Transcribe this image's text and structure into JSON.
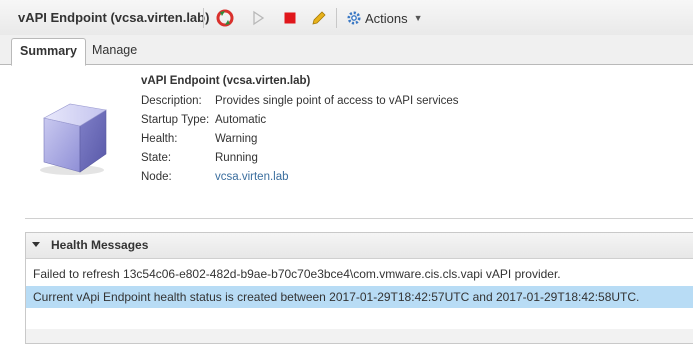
{
  "header": {
    "title": "vAPI Endpoint (vcsa.virten.lab)",
    "actions_label": "Actions",
    "toolbar_icons": [
      "refresh-icon",
      "play-icon",
      "stop-icon",
      "edit-icon",
      "gear-icon"
    ],
    "colors": {
      "refresh": "#d9302c",
      "stop": "#e0161b",
      "edit": "#e8b21a",
      "gear": "#3a78c4"
    }
  },
  "tabs": [
    {
      "label": "Summary",
      "active": true
    },
    {
      "label": "Manage",
      "active": false
    }
  ],
  "summary": {
    "name": "vAPI Endpoint (vcsa.virten.lab)",
    "fields": [
      {
        "key": "Description:",
        "value": "Provides single point of access to vAPI services"
      },
      {
        "key": "Startup Type:",
        "value": "Automatic"
      },
      {
        "key": "Health:",
        "value": "Warning"
      },
      {
        "key": "State:",
        "value": "Running"
      },
      {
        "key": "Node:",
        "value": "vcsa.virten.lab"
      }
    ]
  },
  "health": {
    "title": "Health Messages",
    "messages": [
      "Failed to refresh 13c54c06-e802-482d-b9ae-b70c70e3bce4\\com.vmware.cis.cls.vapi vAPI provider.",
      "Current vApi Endpoint health status is created between 2017-01-29T18:42:57UTC and 2017-01-29T18:42:58UTC."
    ],
    "selected_index": 1
  }
}
